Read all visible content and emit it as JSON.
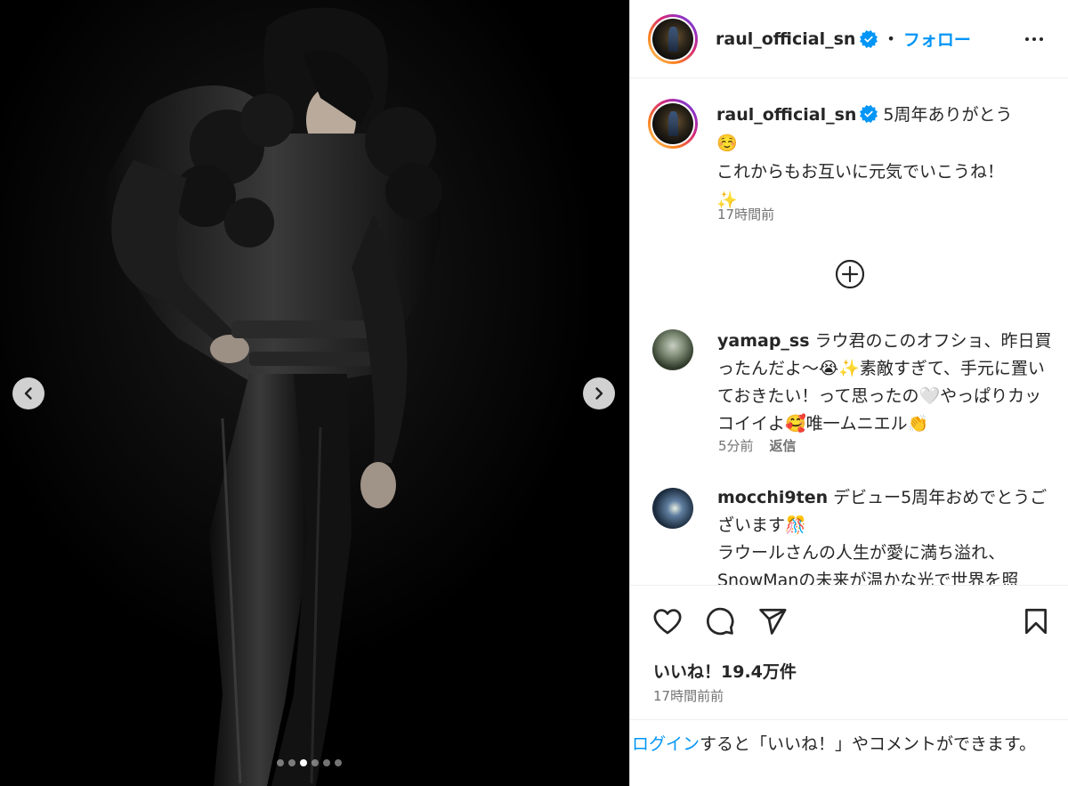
{
  "post": {
    "username": "raul_official_sn",
    "follow_label": "フォロー",
    "separator": "•",
    "caption_line1": "5周年ありがとう",
    "caption_emoji1": "☺️",
    "caption_line2": "これからもお互いに元気でいこうね！",
    "caption_emoji2": "✨",
    "caption_time": "17時間前",
    "likes": "いいね！19.4万件",
    "post_time": "17時間前前"
  },
  "carousel": {
    "slide_count": 6,
    "active_index": 2
  },
  "comments": [
    {
      "username": "yamap_ss",
      "text": "ラウ君のこのオフショ、昨日買ったんだよ〜😭✨素敵すぎて、手元に置いておきたい！って思ったの🤍やっぱりカッコイイよ🥰唯一ムニエル👏",
      "time": "5分前",
      "reply_label": "返信"
    },
    {
      "username": "mocchi9ten",
      "text": "デビュー5周年おめでとうございます🎊\nラウールさんの人生が愛に満ち溢れ、SnowManの未来が温かな光で世界を照"
    }
  ],
  "footer": {
    "login_link": "ログイン",
    "login_rest": "すると「いいね！」やコメントができます。"
  },
  "icons": {
    "verified": "verified-badge-icon",
    "more": "more-options-icon",
    "plus": "load-more-comments-icon",
    "like": "heart-icon",
    "comment": "comment-icon",
    "share": "share-icon",
    "save": "bookmark-icon",
    "prev": "chevron-left-icon",
    "next": "chevron-right-icon"
  },
  "colors": {
    "accent": "#0095f6",
    "verified": "#0095f6",
    "text": "#262626",
    "secondary": "#737373"
  }
}
